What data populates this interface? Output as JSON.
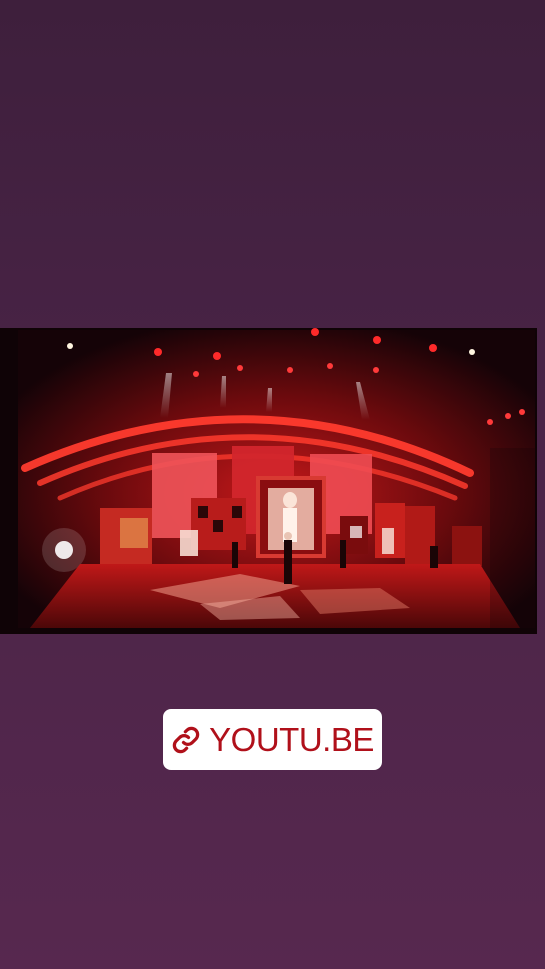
{
  "story": {
    "background_colors": [
      "#3e1f3c",
      "#57284f"
    ],
    "photo": {
      "subject": "stage-performance-screen-capture"
    },
    "link_sticker": {
      "icon": "link-icon",
      "label": "YOUTU.BE",
      "text_color": "#b0101a",
      "background": "#ffffff"
    }
  }
}
